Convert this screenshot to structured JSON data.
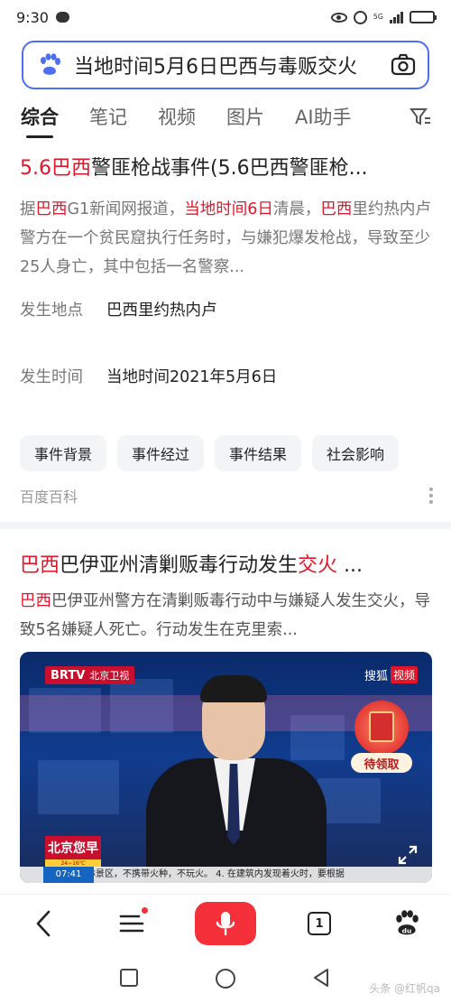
{
  "status_bar": {
    "time": "9:30",
    "network_label": "5G",
    "battery_level": 0.8
  },
  "search": {
    "query": "当地时间5月6日巴西与毒贩交火",
    "icons": {
      "left": "baidu-paw-icon",
      "right": "camera-icon"
    }
  },
  "tabs": [
    {
      "label": "综合",
      "active": true
    },
    {
      "label": "笔记",
      "active": false
    },
    {
      "label": "视频",
      "active": false
    },
    {
      "label": "图片",
      "active": false
    },
    {
      "label": "AI助手",
      "active": false
    }
  ],
  "result1": {
    "title_hl1": "5.6巴西",
    "title_rest": "警匪枪战事件(5.6巴西警匪枪...",
    "abstract_parts": [
      "据",
      "巴西",
      "G1新闻网报道，",
      "当地时间6日",
      "清晨，",
      "巴西",
      "里约热内卢警方在一个贫民窟执行任务时，与嫌犯爆发枪战，导致至少25人身亡，其中包括一名警察..."
    ],
    "location_key": "发生地点",
    "location_value": "巴西里约热内卢",
    "time_key": "发生时间",
    "time_value": "当地时间2021年5月6日",
    "chips": [
      "事件背景",
      "事件经过",
      "事件结果",
      "社会影响"
    ],
    "source": "百度百科"
  },
  "result2": {
    "title_hl1": "巴西",
    "title_mid": "巴伊亚州清剿贩毒行动发生",
    "title_hl2": "交火",
    "title_end": " ...",
    "abstract_hl": "巴西",
    "abstract_rest": "巴伊亚州警方在清剿贩毒行动中与嫌疑人发生交火，导致5名嫌疑人死亡。行动发生在克里索...",
    "video": {
      "channel_logo": "BRTV",
      "channel_name": "北京卫视",
      "platform": "搜狐",
      "platform_tag": "视频",
      "redpacket_label": "待领取",
      "program_logo": "北京您早",
      "weather": "24~16℃",
      "ticker_time": "07:41",
      "ticker_text": "上山林景区，不携带火种，不玩火。   4. 在建筑内发现着火时，要根据"
    }
  },
  "bottom_nav": {
    "tab_count": "1"
  },
  "watermark": "头条 @红帆qa"
}
